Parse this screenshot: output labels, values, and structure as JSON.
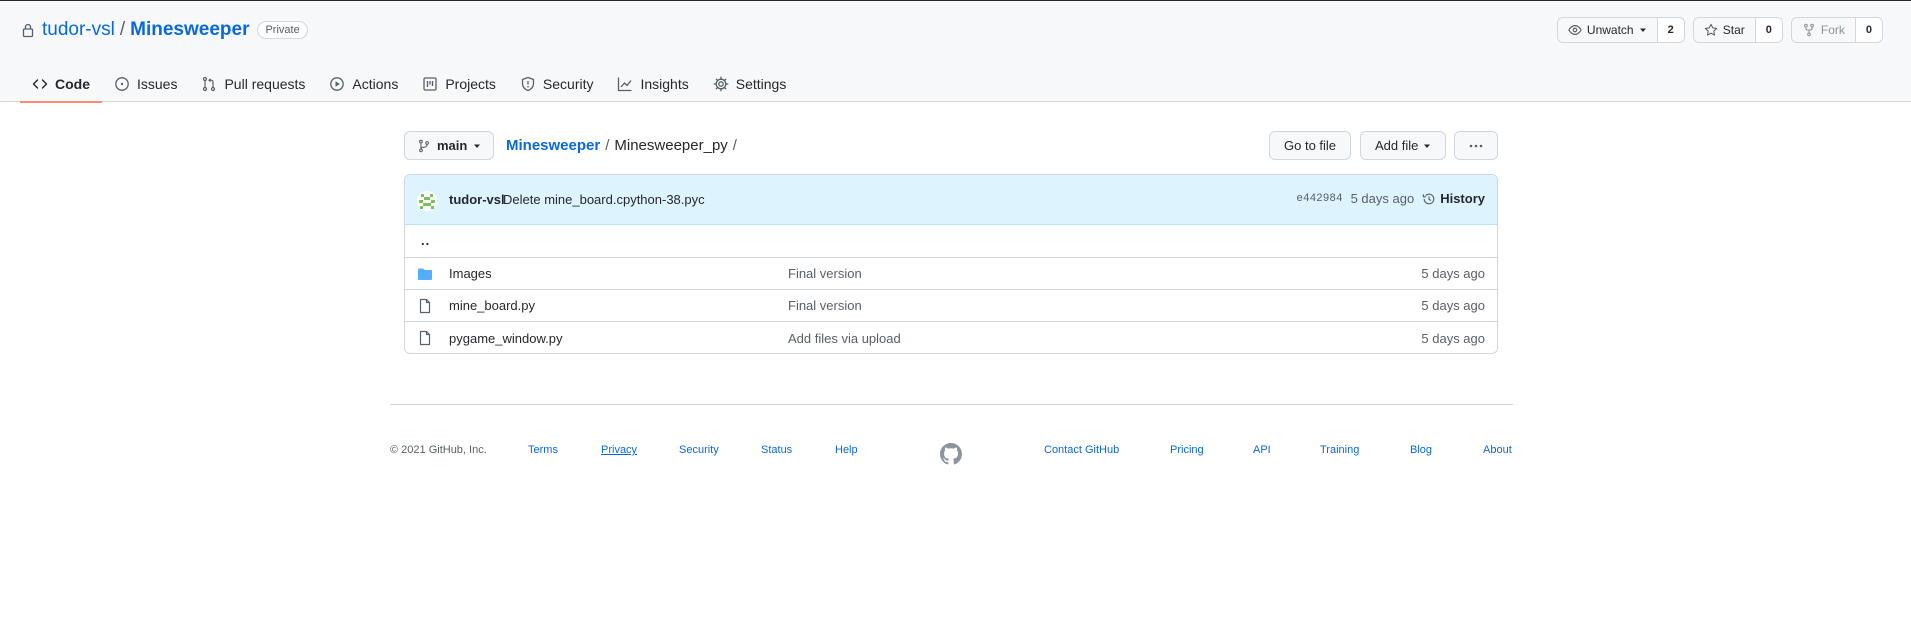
{
  "repo": {
    "owner": "tudor-vsl",
    "separator": "/",
    "name": "Minesweeper",
    "visibility": "Private"
  },
  "actions": {
    "watch": {
      "label": "Unwatch",
      "count": "2"
    },
    "star": {
      "label": "Star",
      "count": "0"
    },
    "fork": {
      "label": "Fork",
      "count": "0"
    }
  },
  "tabs": [
    {
      "label": "Code",
      "icon": "code-icon",
      "active": true
    },
    {
      "label": "Issues",
      "icon": "issue-icon"
    },
    {
      "label": "Pull requests",
      "icon": "pull-request-icon"
    },
    {
      "label": "Actions",
      "icon": "play-icon"
    },
    {
      "label": "Projects",
      "icon": "project-icon"
    },
    {
      "label": "Security",
      "icon": "shield-icon"
    },
    {
      "label": "Insights",
      "icon": "graph-icon"
    },
    {
      "label": "Settings",
      "icon": "gear-icon"
    }
  ],
  "toolbar": {
    "branch": "main",
    "breadcrumb_root": "Minesweeper",
    "breadcrumb_sep": "/",
    "breadcrumb_current": "Minesweeper_py",
    "breadcrumb_trailing": "/",
    "go_to_file": "Go to file",
    "add_file": "Add file"
  },
  "commit": {
    "author": "tudor-vsl",
    "message": "Delete mine_board.cpython-38.pyc",
    "sha": "e442984",
    "age": "5 days ago",
    "history_label": "History"
  },
  "files": {
    "parent": "..",
    "rows": [
      {
        "name": "Images",
        "type": "folder",
        "message": "Final version",
        "age": "5 days ago"
      },
      {
        "name": "mine_board.py",
        "type": "file",
        "message": "Final version",
        "age": "5 days ago"
      },
      {
        "name": "pygame_window.py",
        "type": "file",
        "message": "Add files via upload",
        "age": "5 days ago"
      }
    ]
  },
  "footer": {
    "copyright": "© 2021 GitHub, Inc.",
    "links_left": [
      "Terms",
      "Privacy",
      "Security",
      "Status",
      "Help"
    ],
    "links_right": [
      "Contact GitHub",
      "Pricing",
      "API",
      "Training",
      "Blog",
      "About"
    ]
  },
  "colors": {
    "link": "#0969da",
    "tab_underline": "#fd8c73",
    "commit_bg": "#ddf4ff",
    "folder": "#54aeff"
  }
}
